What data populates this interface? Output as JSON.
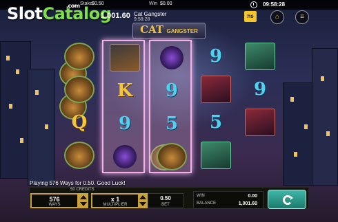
{
  "watermark": {
    "slot": "Slot",
    "catalog": "Catalog",
    "com": ".com"
  },
  "topbar": {
    "stake_label": "Stake",
    "stake_value": "$0.50",
    "win_label": "Win",
    "win_value": "$0.00",
    "time": "09:58:28"
  },
  "header": {
    "balance": "1,001.60",
    "game_name": "Cat Gangster",
    "game_time": "9:58:28",
    "provider_logo": "hs"
  },
  "logo": {
    "cat": "CAT",
    "gangster": "GANGSTER"
  },
  "reels": [
    [
      "cat-gold",
      "cat-gold",
      "Q",
      "cat-gold"
    ],
    [
      "cat-boss",
      "K",
      "9",
      "cat-purple"
    ],
    [
      "cat-purple",
      "9",
      "5",
      "cat-gold"
    ],
    [
      "9",
      "cat-red",
      "5",
      "cat-green"
    ],
    [
      "cat-green",
      "9",
      "cat-red",
      ""
    ]
  ],
  "message": "Playing 576 Ways for 0.50. Good Luck!",
  "controls": {
    "credits_label": "50 CREDITS",
    "ways_value": "576",
    "ways_label": "WAYS",
    "multiplier_value": "x 1",
    "multiplier_label": "MULTIPLIER",
    "bet_value": "0.50",
    "bet_label": "BET",
    "win_label": "WIN",
    "win_value": "0.00",
    "balance_label": "BALANCE",
    "balance_value": "1,001.60"
  },
  "icons": [
    "clock-icon",
    "home-icon",
    "menu-icon",
    "spin-icon",
    "arrow-up-icon",
    "arrow-down-icon"
  ]
}
